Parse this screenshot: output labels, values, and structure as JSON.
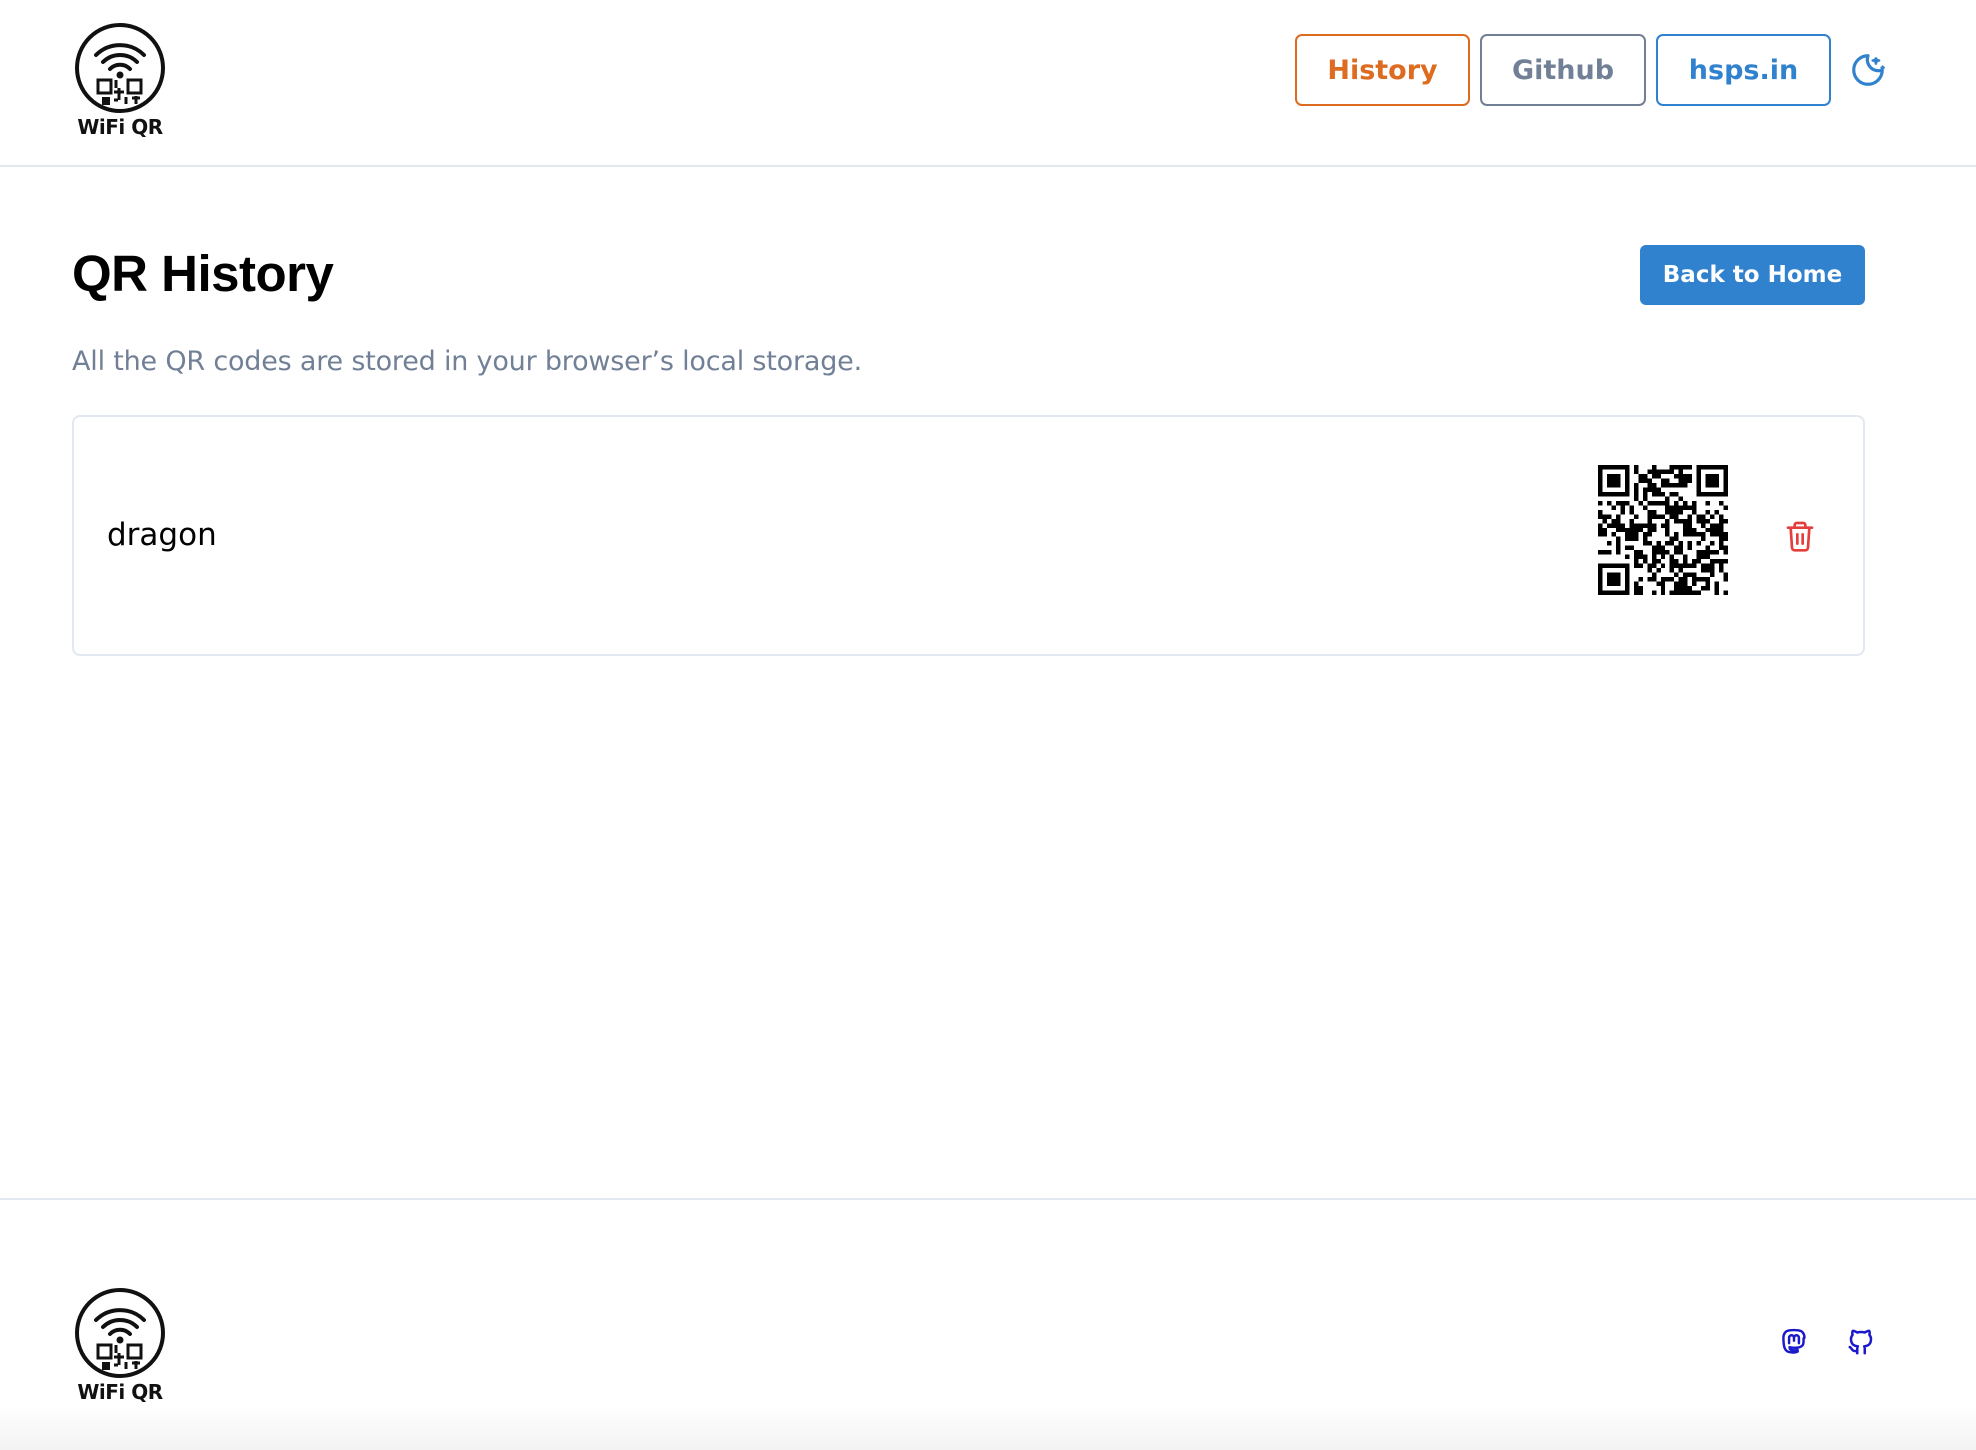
{
  "header": {
    "logo_text": "WiFi QR",
    "nav": {
      "history": "History",
      "github": "Github",
      "hsps": "hsps.in"
    },
    "theme_toggle_icon": "moon-stars-icon"
  },
  "main": {
    "title": "QR History",
    "back_button": "Back to Home",
    "subtitle": "All the QR codes are stored in your browser’s local storage.",
    "history": [
      {
        "ssid": "dragon",
        "qr_icon": "qr-code",
        "delete_icon": "trash-icon"
      }
    ]
  },
  "footer": {
    "logo_text": "WiFi QR",
    "social_icons": [
      "mastodon-icon",
      "github-icon"
    ]
  },
  "colors": {
    "history": "#dd6b20",
    "github": "#718096",
    "accent": "#3182ce",
    "delete": "#e53e3e",
    "social": "#1a1acc"
  }
}
